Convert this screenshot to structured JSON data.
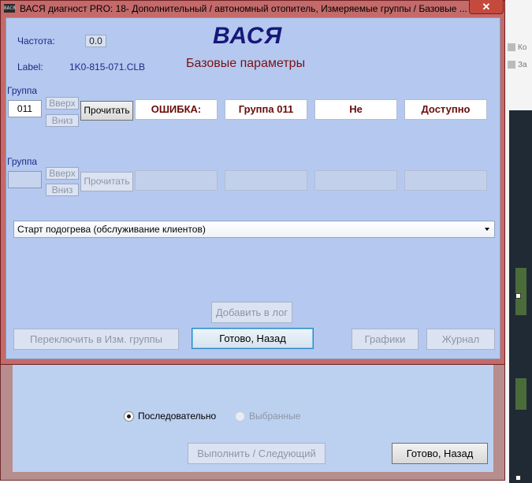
{
  "window": {
    "title": "ВАСЯ диагност PRO: 18- Дополнительный / автономный отопитель,  Измеряемые группы / Базовые ...",
    "app_icon_text": "ВАСЯ",
    "close_symbol": "✕"
  },
  "header": {
    "frequency_label": "Частота:",
    "frequency_value": "0.0",
    "label_caption": "Label:",
    "label_value": "1K0-815-071.CLB",
    "app_title": "ВАСЯ",
    "subtitle": "Базовые параметры"
  },
  "groups": [
    {
      "caption": "Группа",
      "value": "011",
      "up_label": "Вверх",
      "down_label": "Вниз",
      "read_label": "Прочитать",
      "fields": [
        "ОШИБКА:",
        "Группа 011",
        "Не",
        "Доступно"
      ]
    },
    {
      "caption": "Группа",
      "value": "",
      "up_label": "Вверх",
      "down_label": "Вниз",
      "read_label": "Прочитать",
      "fields": [
        "",
        "",
        "",
        ""
      ]
    }
  ],
  "function_select": {
    "selected": "Старт подогрева (обслуживание клиентов)"
  },
  "buttons": {
    "add_to_log": "Добавить в лог",
    "switch_groups": "Переключить в Изм. группы",
    "done_back": "Готово, Назад",
    "graphs": "Графики",
    "log": "Журнал"
  },
  "background_dialog": {
    "radio_sequential": "Последовательно",
    "radio_selected": "Выбранные",
    "execute_next": "Выполнить / Следующий",
    "done_back": "Готово, Назад"
  },
  "background_app": {
    "toolbar_items": [
      "Ко",
      "За"
    ]
  },
  "colors": {
    "client_bg": "#b5c8ef",
    "window_frame": "#c46a6a",
    "title_blue": "#17177a",
    "subtitle_red": "#7a1212",
    "field_text": "#6b0b0b"
  }
}
